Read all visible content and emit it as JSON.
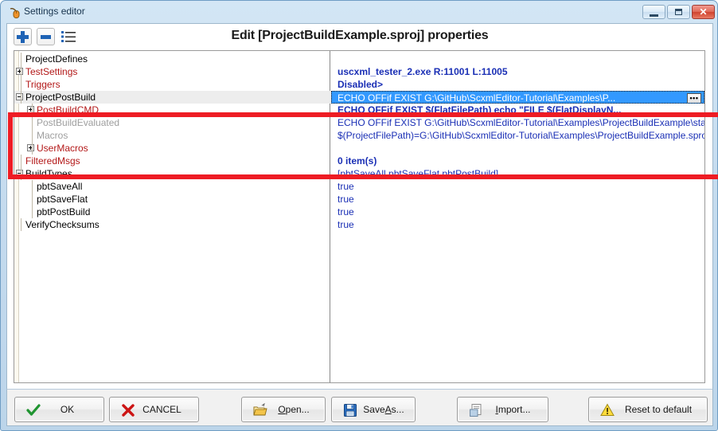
{
  "window": {
    "title": "Settings editor",
    "icon": "mouse-icon",
    "controls": {
      "minimize": "minimize",
      "maximize": "maximize",
      "close": "close"
    }
  },
  "toolbar": {
    "add_label": "add-item",
    "remove_label": "remove-item",
    "list_label": "list-view",
    "page_title": "Edit [ProjectBuildExample.sproj] properties"
  },
  "grid": {
    "rows": [
      {
        "name": "ProjectDefines",
        "indent": 0,
        "expander": "none",
        "name_color": "black",
        "value": "",
        "value_bold": false,
        "selected": false,
        "row_bg": "white"
      },
      {
        "name": "TestSettings",
        "indent": 0,
        "expander": "plus",
        "name_color": "red",
        "value": "uscxml_tester_2.exe R:11001 L:11005",
        "value_bold": true,
        "selected": false,
        "row_bg": "white"
      },
      {
        "name": "Triggers",
        "indent": 0,
        "expander": "none",
        "name_color": "red",
        "value": "Disabled>",
        "value_bold": true,
        "selected": false,
        "row_bg": "white"
      },
      {
        "name": "ProjectPostBuild",
        "indent": 0,
        "expander": "minus",
        "name_color": "black",
        "value": "ECHO OFFif EXIST G:\\GitHub\\ScxmlEditor-Tutorial\\Examples\\P...",
        "value_bold": false,
        "selected": true,
        "row_bg": "gray"
      },
      {
        "name": "PostBuildCMD",
        "indent": 1,
        "expander": "plus",
        "name_color": "red",
        "value": "ECHO OFFif EXIST $(FlatFilePath) echo \"FILE $(FlatDisplayN...",
        "value_bold": true,
        "selected": false,
        "row_bg": "white"
      },
      {
        "name": "PostBuildEvaluated",
        "indent": 1,
        "expander": "none",
        "name_color": "gray",
        "value": "ECHO OFFif EXIST G:\\GitHub\\ScxmlEditor-Tutorial\\Examples\\ProjectBuildExample\\state_machine_pro",
        "value_bold": false,
        "selected": false,
        "row_bg": "white"
      },
      {
        "name": "Macros",
        "indent": 1,
        "expander": "none",
        "name_color": "gray",
        "value": "$(ProjectFilePath)=G:\\GitHub\\ScxmlEditor-Tutorial\\Examples\\ProjectBuildExample.sproj$(DisplayNam",
        "value_bold": false,
        "selected": false,
        "row_bg": "white"
      },
      {
        "name": "UserMacros",
        "indent": 1,
        "expander": "plus",
        "name_color": "red",
        "value": "",
        "value_bold": false,
        "selected": false,
        "row_bg": "white"
      },
      {
        "name": "FilteredMsgs",
        "indent": 0,
        "expander": "none",
        "name_color": "red",
        "value": "0 item(s)",
        "value_bold": true,
        "selected": false,
        "row_bg": "white"
      },
      {
        "name": "BuildTypes",
        "indent": 0,
        "expander": "minus",
        "name_color": "black",
        "value": "[pbtSaveAll,pbtSaveFlat,pbtPostBuild]",
        "value_bold": false,
        "selected": false,
        "row_bg": "white"
      },
      {
        "name": "pbtSaveAll",
        "indent": 1,
        "expander": "none",
        "name_color": "black",
        "value": "true",
        "value_bold": false,
        "selected": false,
        "row_bg": "white"
      },
      {
        "name": "pbtSaveFlat",
        "indent": 1,
        "expander": "none",
        "name_color": "black",
        "value": "true",
        "value_bold": false,
        "selected": false,
        "row_bg": "white"
      },
      {
        "name": "pbtPostBuild",
        "indent": 1,
        "expander": "none",
        "name_color": "black",
        "value": "true",
        "value_bold": false,
        "selected": false,
        "row_bg": "white"
      },
      {
        "name": "VerifyChecksums",
        "indent": 0,
        "expander": "none",
        "name_color": "black",
        "value": "true",
        "value_bold": false,
        "selected": false,
        "row_bg": "white"
      }
    ],
    "ellipsis_button_label": "•••"
  },
  "annotation": {
    "color": "#ee1c24",
    "name": "red-highlight-rectangle"
  },
  "buttons": [
    {
      "id": "ok",
      "label": "OK",
      "icon": "check-icon",
      "underline_index": -1
    },
    {
      "id": "cancel",
      "label": "CANCEL",
      "icon": "x-icon",
      "underline_index": -1
    },
    {
      "id": "open",
      "label": "Open...",
      "icon": "folder-icon",
      "underline_index": 0
    },
    {
      "id": "saveas",
      "label": "Save As...",
      "icon": "floppy-icon",
      "underline_index": 5
    },
    {
      "id": "import",
      "label": "Import...",
      "icon": "document-icon",
      "underline_index": 0
    },
    {
      "id": "reset",
      "label": "Reset to default",
      "icon": "warning-icon",
      "underline_index": -1
    }
  ],
  "colors": {
    "selection_blue": "#3399ff",
    "value_text_blue": "#1a2fb5",
    "name_red": "#b31818",
    "name_gray": "#9e9e9e",
    "annotation_red": "#ee1c24",
    "row_alt_gray": "#ededed"
  }
}
